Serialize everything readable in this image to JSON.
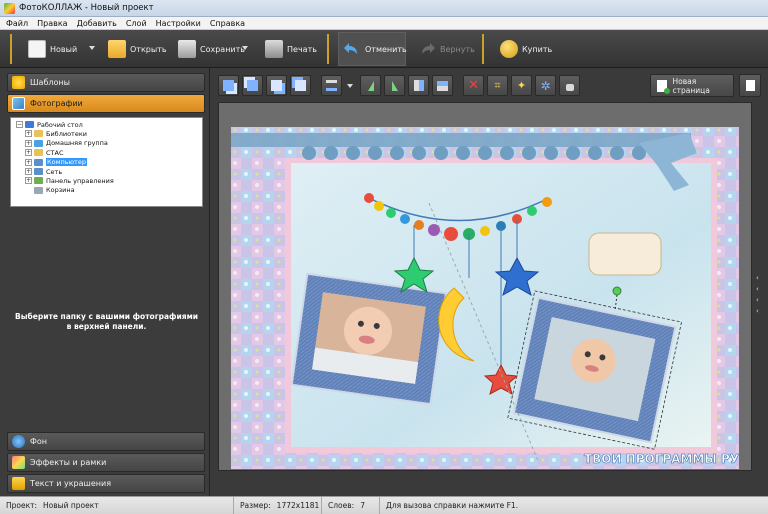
{
  "window": {
    "title": "ФотоКОЛЛАЖ - Новый проект"
  },
  "menu": [
    "Файл",
    "Правка",
    "Добавить",
    "Слой",
    "Настройки",
    "Справка"
  ],
  "toolbar": {
    "new_label": "Новый",
    "open_label": "Открыть",
    "save_label": "Сохранить",
    "print_label": "Печать",
    "undo_label": "Отменить",
    "redo_label": "Вернуть",
    "buy_label": "Купить"
  },
  "sidebar": {
    "templates_label": "Шаблоны",
    "photos_label": "Фотографии",
    "tree": [
      {
        "label": "Рабочий стол",
        "level": 0,
        "expander": "−",
        "selected": false,
        "icon_color": "#3d7bd6"
      },
      {
        "label": "Библиотеки",
        "level": 1,
        "expander": "+",
        "selected": false,
        "icon_color": "#e8c15a"
      },
      {
        "label": "Домашняя группа",
        "level": 1,
        "expander": "+",
        "selected": false,
        "icon_color": "#4aa3e0"
      },
      {
        "label": "СТАС",
        "level": 1,
        "expander": "+",
        "selected": false,
        "icon_color": "#e8c15a"
      },
      {
        "label": "Компьютер",
        "level": 1,
        "expander": "+",
        "selected": true,
        "icon_color": "#5b8fc9"
      },
      {
        "label": "Сеть",
        "level": 1,
        "expander": "+",
        "selected": false,
        "icon_color": "#5b8fc9"
      },
      {
        "label": "Панель управления",
        "level": 1,
        "expander": "+",
        "selected": false,
        "icon_color": "#6fae4f"
      },
      {
        "label": "Корзина",
        "level": 1,
        "expander": "",
        "selected": false,
        "icon_color": "#9aa7b4"
      }
    ],
    "hint_line1": "Выберите папку с вашими фотографиями",
    "hint_line2": "в верхней панели.",
    "background_label": "Фон",
    "effects_label": "Эффекты и рамки",
    "text_label": "Текст и украшения"
  },
  "edit_toolbar": {
    "new_page_label": "Новая страница"
  },
  "canvas": {
    "watermark": "ТВОИ ПРОГРАММЫ РУ"
  },
  "status": {
    "project_label": "Проект:",
    "project_value": "Новый проект",
    "size_label": "Размер:",
    "size_value": "1772x1181",
    "layers_label": "Слоев:",
    "layers_value": "7",
    "help_text": "Для вызова справки нажмите F1."
  }
}
